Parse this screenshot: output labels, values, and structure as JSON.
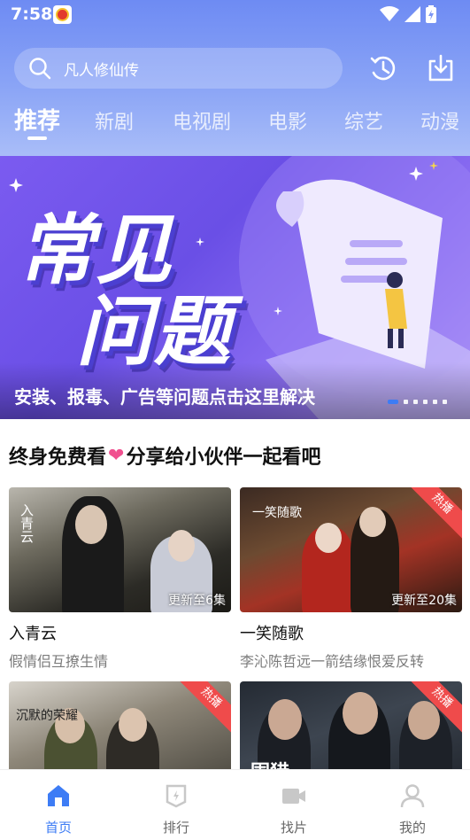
{
  "status_bar": {
    "time": "7:58"
  },
  "search": {
    "placeholder": "凡人修仙传"
  },
  "tabs": [
    {
      "label": "推荐",
      "active": true
    },
    {
      "label": "新剧"
    },
    {
      "label": "电视剧"
    },
    {
      "label": "电影"
    },
    {
      "label": "综艺"
    },
    {
      "label": "动漫"
    }
  ],
  "banner": {
    "title_line1": "常见",
    "title_line2": "问题",
    "caption": "安装、报毒、广告等问题点击这里解决",
    "slide_count": 6,
    "active_slide": 1
  },
  "section": {
    "title_part1": "终身免费看",
    "title_part2": "分享给小伙伴一起看吧"
  },
  "cards": [
    {
      "title": "入青云",
      "subtitle": "假情侣互撩生情",
      "update": "更新至6集",
      "poster_text": "入青云"
    },
    {
      "title": "一笑随歌",
      "subtitle": "李沁陈哲远一箭结缘恨爱反转",
      "update": "更新至20集",
      "badge": "热播",
      "poster_text": "一笑随歌"
    },
    {
      "badge": "热播",
      "poster_text": "沉默的荣耀"
    },
    {
      "badge": "热播",
      "poster_text": "围猎"
    }
  ],
  "bottom_nav": [
    {
      "label": "首页",
      "icon": "home-icon",
      "active": true
    },
    {
      "label": "排行",
      "icon": "ranking-icon"
    },
    {
      "label": "找片",
      "icon": "video-camera-icon"
    },
    {
      "label": "我的",
      "icon": "user-icon"
    }
  ],
  "colors": {
    "accent": "#3d7cf5",
    "header": "#7b95f4",
    "hot_badge": "#ef4b4b",
    "heart": "#f0508f"
  }
}
